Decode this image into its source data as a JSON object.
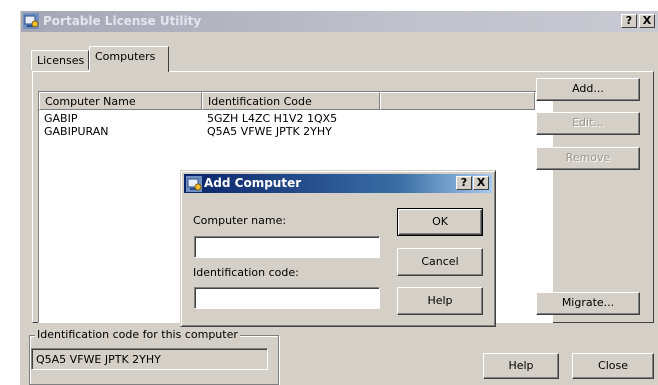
{
  "window": {
    "title": "Portable License Utility",
    "help_label": "?",
    "close_label": "X"
  },
  "tabs": [
    {
      "label": "Licenses",
      "selected": false
    },
    {
      "label": "Computers",
      "selected": true
    }
  ],
  "list": {
    "columns": [
      "Computer Name",
      "Identification Code",
      ""
    ],
    "rows": [
      {
        "name": "GABIP",
        "code": "5GZH L4ZC H1V2 1QX5"
      },
      {
        "name": "GABIPURAN",
        "code": "Q5A5 VFWE JPTK 2YHY"
      }
    ]
  },
  "side_buttons": {
    "add": "Add...",
    "edit": "Edit...",
    "remove": "Remove",
    "migrate": "Migrate..."
  },
  "id_group": {
    "legend": "Identification code for this computer",
    "value": "Q5A5 VFWE JPTK 2YHY"
  },
  "footer": {
    "help": "Help",
    "close": "Close"
  },
  "dialog": {
    "title": "Add Computer",
    "help_label": "?",
    "close_label": "X",
    "computer_name_label": "Computer name:",
    "computer_name_value": "",
    "id_code_label": "Identification code:",
    "id_code_value": "",
    "ok": "OK",
    "cancel": "Cancel",
    "help": "Help"
  },
  "colors": {
    "face": "#d4d0c8",
    "active_title": "#0a246a",
    "inactive_title": "#bfc1cb"
  }
}
